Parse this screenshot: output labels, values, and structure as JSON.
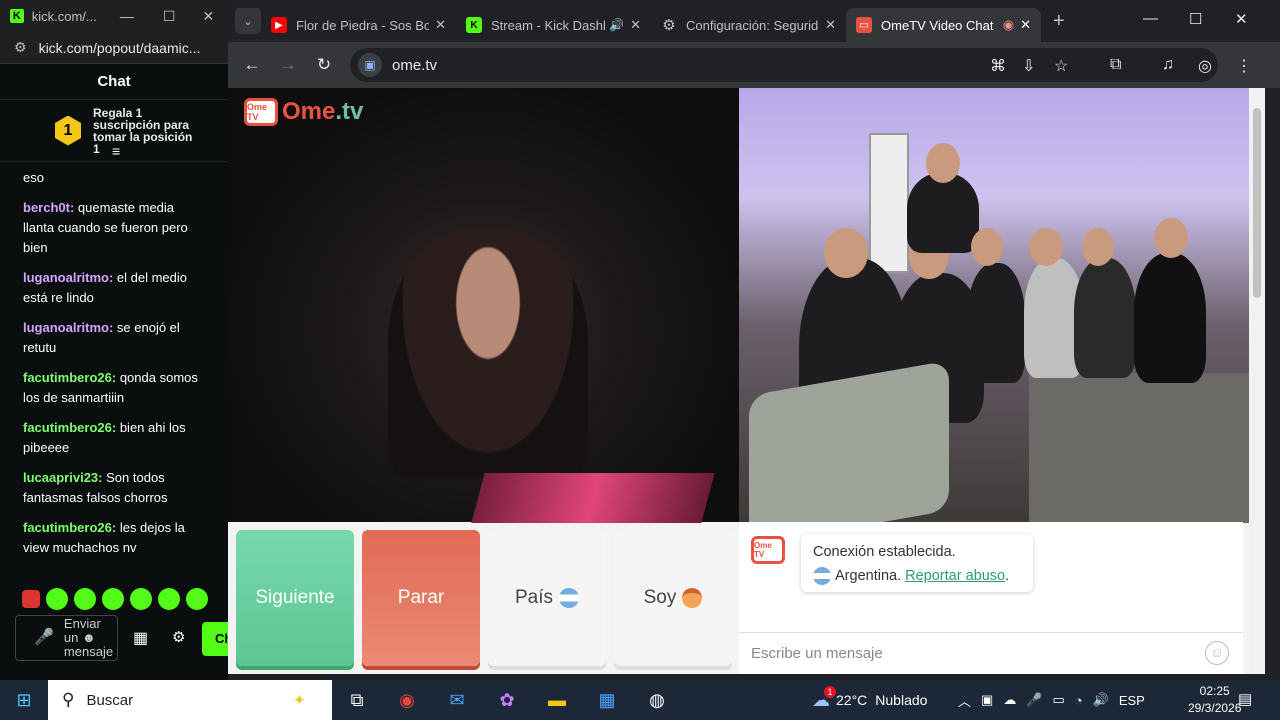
{
  "kick_window": {
    "title": "kick.com/...",
    "url": "kick.com/popout/daamic...",
    "chat_header": "Chat",
    "sub_banner": {
      "rank": "1",
      "text": "Regala 1 suscripción para tomar la posición 1"
    },
    "messages": [
      {
        "user": "",
        "text": "eso",
        "color": "#ffffff"
      },
      {
        "user": "berch0t:",
        "text": "quemaste media llanta cuando se fueron pero bien",
        "color": "#d7a4ff"
      },
      {
        "user": "luganoalritmo:",
        "text": "el del medio está re lindo",
        "color": "#d7a4ff"
      },
      {
        "user": "luganoalritmo:",
        "text": "se enojó el retutu",
        "color": "#d7a4ff"
      },
      {
        "user": "facutimbero26:",
        "text": "qonda somos los de sanmartiiin",
        "color": "#7dff6f"
      },
      {
        "user": "facutimbero26:",
        "text": "bien ahi los pibeeee",
        "color": "#7dff6f"
      },
      {
        "user": "lucaaprivi23:",
        "text": "Son todos fantasmas falsos chorros",
        "color": "#7dff6f"
      },
      {
        "user": "facutimbero26:",
        "text": "les dejos la view muchachos nv",
        "color": "#7dff6f"
      }
    ],
    "input_placeholder": "Enviar un ☻ mensaje",
    "send_label": "Ch"
  },
  "browser": {
    "tabs": [
      {
        "title": "Flor de Piedra - Sos Bot",
        "icon": "youtube-icon",
        "color": "#ff0000"
      },
      {
        "title": "Stream - Kick Dashboard",
        "icon": "kick-icon",
        "color": "#53fc18"
      },
      {
        "title": "Configuración: Seguridad",
        "icon": "gear-icon",
        "color": "#bdc1c6"
      },
      {
        "title": "OmeTV Video Chat",
        "icon": "ometv-icon",
        "color": "#e8523f"
      }
    ],
    "url": "ome.tv"
  },
  "page": {
    "logo": {
      "tv": "Ome TV",
      "ome": "Ome",
      "dot": ".",
      "tv2": "tv"
    },
    "buttons": {
      "next": "Siguiente",
      "stop": "Parar",
      "country": "País",
      "gender": "Soy"
    },
    "chat": {
      "status": "Conexión establecida.",
      "country": "Argentina.",
      "report": "Reportar abuso",
      "report_suffix": ".",
      "placeholder": "Escribe un mensaje"
    }
  },
  "taskbar": {
    "search": "Buscar",
    "weather": {
      "temp": "22°C",
      "desc": "Nublado",
      "badge": "1"
    },
    "lang": "ESP",
    "time": "02:25",
    "date": "29/3/2026"
  },
  "colors": {
    "kick_green": "#53fc18",
    "ometv_red": "#e8523f",
    "ometv_green": "#5cc694"
  }
}
